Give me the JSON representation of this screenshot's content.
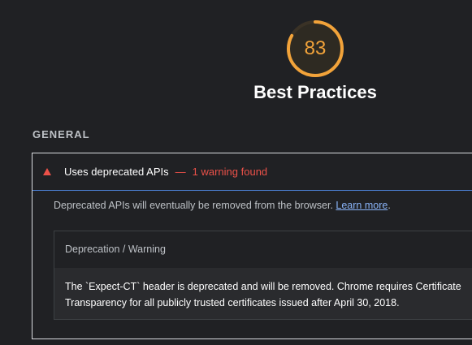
{
  "gauge": {
    "score": "83",
    "fraction": 0.83,
    "color": "#f2a33a"
  },
  "category": {
    "title": "Best Practices"
  },
  "group": {
    "title": "GENERAL"
  },
  "audit": {
    "icon": "warning-triangle-icon",
    "title": "Uses deprecated APIs",
    "separator": "—",
    "warning": "1 warning found",
    "warning_color": "#eb5149",
    "description": "Deprecated APIs will eventually be removed from the browser.",
    "learn_more": "Learn more",
    "description_end": "."
  },
  "details": {
    "column_header": "Deprecation / Warning",
    "rows": [
      {
        "line1": "The `Expect-CT` header is deprecated and will be removed. Chrome requires Certificate",
        "line2": "Transparency for all publicly trusted certificates issued after April 30, 2018."
      }
    ]
  }
}
